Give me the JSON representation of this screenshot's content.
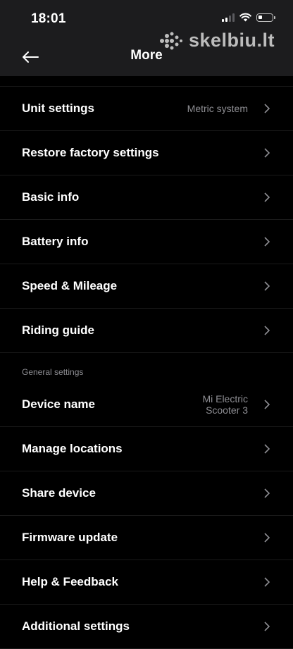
{
  "status_bar": {
    "time": "18:01",
    "icons": [
      "signal-icon",
      "wifi-icon",
      "battery-icon"
    ],
    "battery_level": 0.25
  },
  "watermark": {
    "text": "skelbiu.lt"
  },
  "nav": {
    "title": "More",
    "back_icon": "arrow-left-icon"
  },
  "items_group1": [
    {
      "label": "Unit settings",
      "value": "Metric system"
    },
    {
      "label": "Restore factory settings",
      "value": ""
    },
    {
      "label": "Basic info",
      "value": ""
    },
    {
      "label": "Battery info",
      "value": ""
    },
    {
      "label": "Speed & Mileage",
      "value": ""
    },
    {
      "label": "Riding guide",
      "value": ""
    }
  ],
  "section_general": {
    "title": "General settings"
  },
  "items_group2": [
    {
      "label": "Device name",
      "value_line1": "Mi Electric",
      "value_line2": "Scooter 3"
    },
    {
      "label": "Manage locations",
      "value": ""
    },
    {
      "label": "Share device",
      "value": ""
    },
    {
      "label": "Firmware update",
      "value": ""
    },
    {
      "label": "Help & Feedback",
      "value": ""
    },
    {
      "label": "Additional settings",
      "value": ""
    }
  ],
  "colors": {
    "background": "#000000",
    "header": "#1c1c1e",
    "text": "#ffffff",
    "secondary_text": "#8e8e93",
    "chevron": "#8e8e93"
  }
}
